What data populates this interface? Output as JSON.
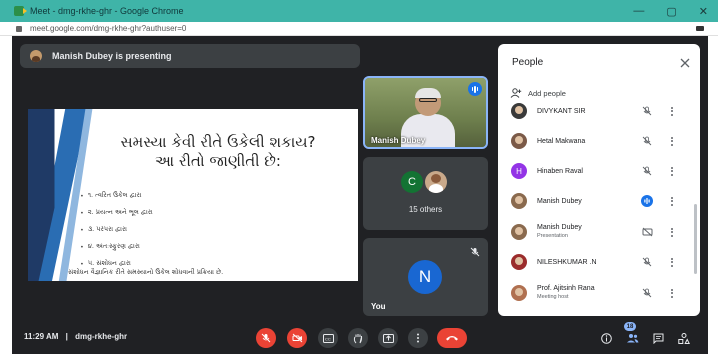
{
  "window": {
    "title": "Meet - dmg-rkhe-ghr - Google Chrome",
    "minimize": "—",
    "maximize": "▢",
    "close": "✕"
  },
  "address_bar": {
    "url": "meet.google.com/dmg-rkhe-ghr?authuser=0"
  },
  "presenting_banner": {
    "text": "Manish Dubey is presenting"
  },
  "slide": {
    "heading_line1": "સમસ્યા કેવી રીતે ઉકેલી શકાય?",
    "heading_line2": "આ રીતો જાણીતી છે:",
    "bullets": [
      "૧. ત્વરિત ઉકેલ દ્વારા",
      "૨. પ્રયત્ન અને ભૂલ દ્વારા",
      "૩. પરંપરા દ્વારા",
      "૪. અંતઃસ્ફુરણ દ્વારા",
      "૫. સંશોધન દ્વારા"
    ],
    "footnote": "સંશોધન વૈજ્ઞાનિક રીતે સમસ્યાનો ઉકેલ શોધવાની પ્રક્રિયા છે."
  },
  "tiles": {
    "speaker_name": "Manish Dubey",
    "others_initial": "C",
    "others_label": "15 others",
    "you_initial": "N",
    "you_label": "You"
  },
  "bottom_bar": {
    "time": "11:29 AM",
    "separator": "|",
    "meeting_code": "dmg-rkhe-ghr",
    "people_count": "18"
  },
  "people_panel": {
    "title": "People",
    "add_people": "Add people",
    "participants": [
      {
        "name": "DIVYKANT SIR",
        "sub": "",
        "avatar": "photo",
        "avatar_color": "#3a3a3a",
        "mic": "muted"
      },
      {
        "name": "Hetal Makwana",
        "sub": "",
        "avatar": "photo",
        "avatar_color": "#7b5a48",
        "mic": "muted"
      },
      {
        "name": "Hinaben Raval",
        "sub": "",
        "avatar": "H",
        "avatar_color": "#9334e6",
        "mic": "muted"
      },
      {
        "name": "Manish Dubey",
        "sub": "",
        "avatar": "photo",
        "avatar_color": "#8a6a4e",
        "mic": "speaking"
      },
      {
        "name": "Manish Dubey",
        "sub": "Presentation",
        "avatar": "photo",
        "avatar_color": "#8a6a4e",
        "mic": "presentation"
      },
      {
        "name": "NILESHKUMAR .N",
        "sub": "",
        "avatar": "photo",
        "avatar_color": "#9b2c2c",
        "mic": "muted"
      },
      {
        "name": "Prof. Ajitsinh Rana",
        "sub": "Meeting host",
        "avatar": "photo",
        "avatar_color": "#b07050",
        "mic": "muted"
      }
    ]
  },
  "colors": {
    "meet_bg": "#202124",
    "tile_bg": "#3c4043",
    "accent_blue": "#1a73e8",
    "end_call_red": "#ea4335",
    "chrome_title_bar": "#3fb4a8"
  }
}
